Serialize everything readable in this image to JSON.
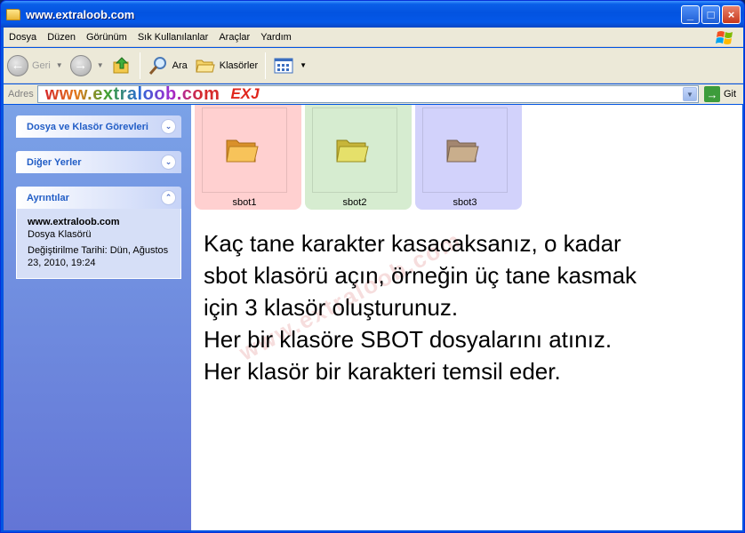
{
  "window": {
    "title": "www.extraloob.com",
    "controls": {
      "minimize": "_",
      "maximize": "□",
      "close": "×"
    }
  },
  "menu": [
    "Dosya",
    "Düzen",
    "Görünüm",
    "Sık Kullanılanlar",
    "Araçlar",
    "Yardım"
  ],
  "toolbar": {
    "back_label": "Geri",
    "search_label": "Ara",
    "folders_label": "Klasörler"
  },
  "address": {
    "label": "Adres",
    "value": "www.extraloob.com",
    "go_label": "Git",
    "logo_text": "EXJ"
  },
  "taskpane": {
    "tasks_title": "Dosya ve Klasör Görevleri",
    "other_places_title": "Diğer Yerler",
    "details_title": "Ayrıntılar",
    "details": {
      "name": "www.extraloob.com",
      "type": "Dosya Klasörü",
      "modified": "Değiştirilme Tarihi: Dün, Ağustos 23, 2010, 19:24"
    }
  },
  "folders": [
    {
      "name": "sbot1",
      "color": "#ffd0d0"
    },
    {
      "name": "sbot2",
      "color": "#d6ecd0"
    },
    {
      "name": "sbot3",
      "color": "#d2d2fb"
    }
  ],
  "instructions": [
    "Kaç tane karakter kasacaksanız, o kadar",
    "sbot klasörü açın, örneğin üç tane kasmak",
    "için 3 klasör oluşturunuz.",
    "Her bir klasöre SBOT dosyalarını atınız.",
    "Her klasör bir karakteri temsil eder."
  ],
  "watermark": "www.extraloob.com"
}
